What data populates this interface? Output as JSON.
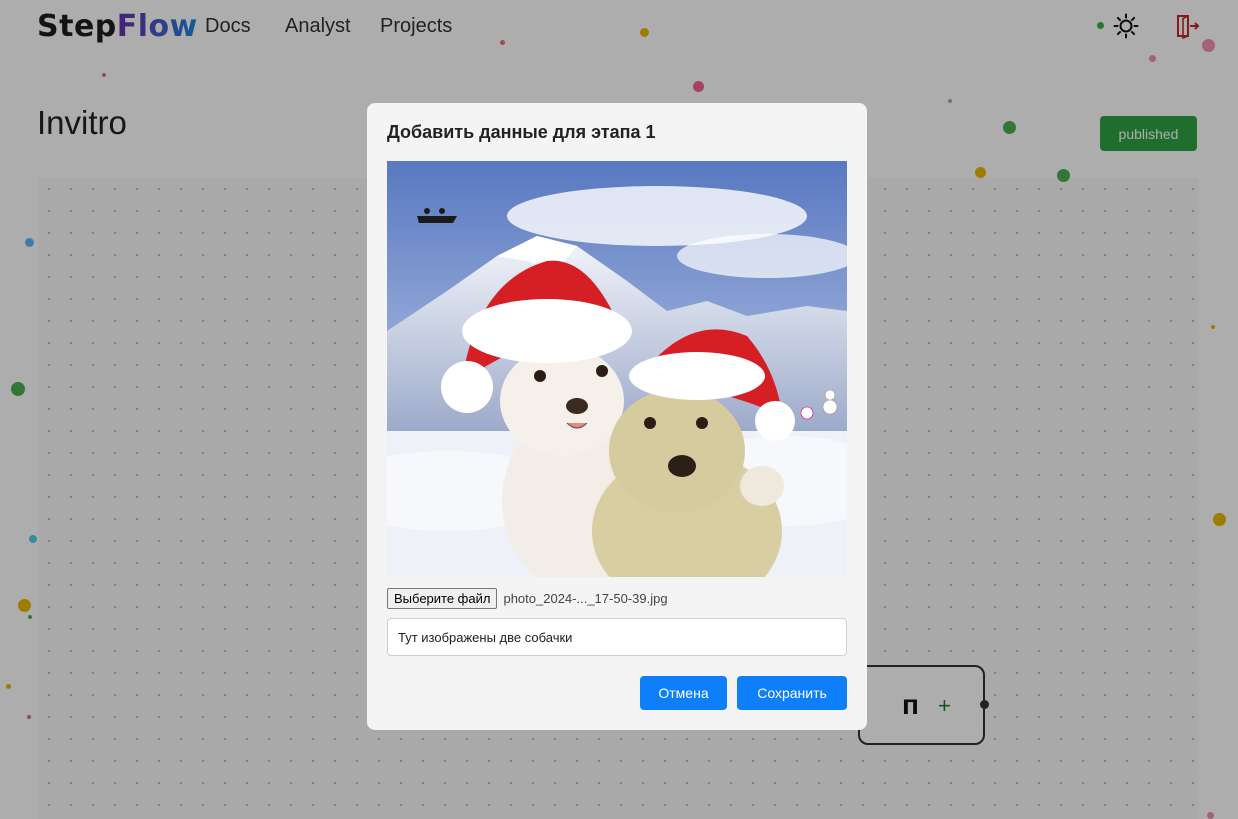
{
  "header": {
    "logo_step": "Step",
    "logo_flow": "Flow",
    "nav": {
      "docs": "Docs",
      "analyst": "Analyst",
      "projects": "Projects"
    },
    "icons": [
      "sun-icon",
      "logout-icon"
    ]
  },
  "page": {
    "title": "Invitro",
    "status_badge": "published"
  },
  "canvas": {
    "node_label": "п",
    "node_add": "+"
  },
  "modal": {
    "title": "Добавить данные для этапа 1",
    "file_button": "Выберите файл",
    "file_name": "photo_2024-..._17-50-39.jpg",
    "description_value": "Тут изображены две собачки",
    "cancel_label": "Отмена",
    "save_label": "Сохранить"
  },
  "colors": {
    "primary": "#0d7ff8",
    "published": "#2ea344",
    "overlay": "rgba(0,0,0,0.32)"
  }
}
